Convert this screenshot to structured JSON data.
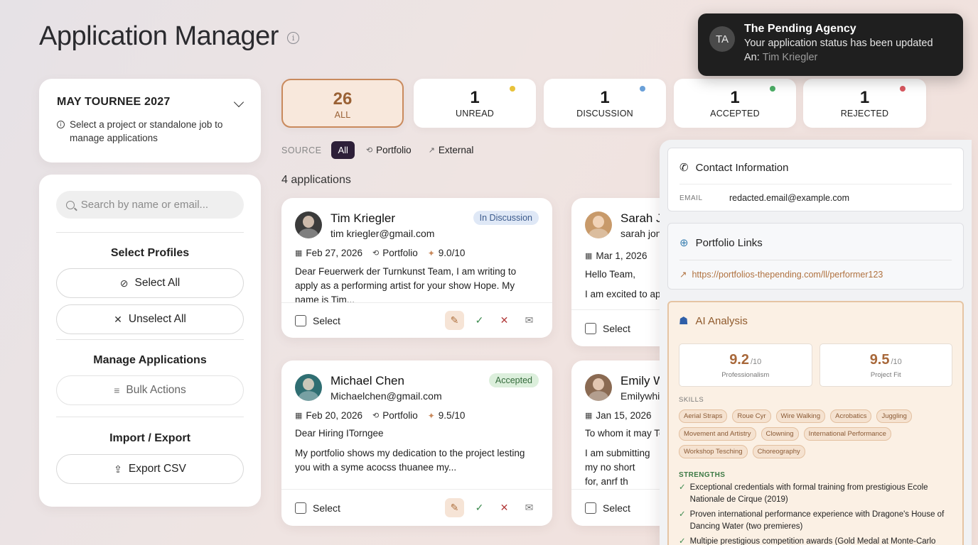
{
  "page": {
    "title": "Application Manager"
  },
  "project": {
    "name": "MAY TOURNEE 2027",
    "hint": "Select a project or standalone job to manage applications"
  },
  "left": {
    "search_placeholder": "Search by name or email...",
    "select_profiles_label": "Select Profiles",
    "select_all_label": "Select All",
    "unselect_all_label": "Unselect All",
    "manage_label": "Manage Applications",
    "bulk_actions_label": "Bulk Actions",
    "import_export_label": "Import / Export",
    "export_csv_label": "Export CSV"
  },
  "stats": [
    {
      "count": "26",
      "label": "ALL",
      "dot": ""
    },
    {
      "count": "1",
      "label": "UNREAD",
      "dot": "#e8c23a"
    },
    {
      "count": "1",
      "label": "DISCUSSION",
      "dot": "#6aa0d8"
    },
    {
      "count": "1",
      "label": "ACCEPTED",
      "dot": "#4cae66"
    },
    {
      "count": "1",
      "label": "REJECTED",
      "dot": "#d9575f"
    }
  ],
  "source": {
    "label": "SOURCE",
    "options": [
      "All",
      "Portfolio",
      "External"
    ]
  },
  "results": {
    "count_label": "4 applications"
  },
  "applications": [
    {
      "name": "Tim Kriegler",
      "email": "tim kriegler@gmail.com",
      "status": "In Discussion",
      "date": "Feb 27, 2026",
      "source": "Portfolio",
      "score": "9.0/10",
      "excerpt": "Dear Feuerwerk der Turnkunst Team, I am writing to apply as a performing artist for your show Hope. My name is Tim..."
    },
    {
      "name": "Sarah Je",
      "email": "sarah jon",
      "status": "",
      "date": "Mar 1, 2026",
      "source": "",
      "score": "",
      "excerpt_line1": "Hello Team,",
      "excerpt_line2": "I am excited to app"
    },
    {
      "name": "Michael Chen",
      "email": "Michaelchen@gmail.com",
      "status": "Accepted",
      "date": "Feb 20, 2026",
      "source": "Portfolio",
      "score": "9.5/10",
      "excerpt_line1": "Dear Hiring ITorngee",
      "excerpt_line2": "My portfolio shows my dedication to the project lesting you with a syme acocss thuanee my..."
    },
    {
      "name": "Emily W",
      "email": "Emilywhi",
      "status": "",
      "date": "Jan 15, 2026",
      "source": "",
      "score": "",
      "excerpt_line1": "To whom it may To",
      "excerpt_line2": "I am submitting my no short for, anrf th"
    }
  ],
  "select_label": "Select",
  "toast": {
    "initials": "TA",
    "title": "The Pending Agency",
    "message": "Your application status has been updated",
    "an_label": "An:",
    "an_value": "Tim Kriegler"
  },
  "detail": {
    "contact_title": "Contact Information",
    "email_key": "EMAIL",
    "email_value": "redacted.email@example.com",
    "links_title": "Portfolio Links",
    "link_url": "https://portfolios-thepending.com/ll/performer123",
    "ai_title": "AI Analysis",
    "scores": [
      {
        "value": "9.2",
        "denom": "/10",
        "caption": "Professionalism"
      },
      {
        "value": "9.5",
        "denom": "/10",
        "caption": "Project Fit"
      }
    ],
    "skills_label": "SKILLS",
    "skills": [
      "Aerial Straps",
      "Roue Cyr",
      "Wire Walking",
      "Acrobatics",
      "Juggling",
      "Movement and Artistry",
      "Clowning",
      "International Performance",
      "Workshop Tesching",
      "Choreography"
    ],
    "strengths_label": "STRENGTHS",
    "strengths": [
      "Exceptional credentials with formal training from prestigious Ecole Nationale de Cirque (2019)",
      "Proven international performance experience with Dragone's House of Dancing Water (two premieres)",
      "Multipie prestigious competition awards (Gold Medal at Monte-Carlo Circus"
    ]
  }
}
